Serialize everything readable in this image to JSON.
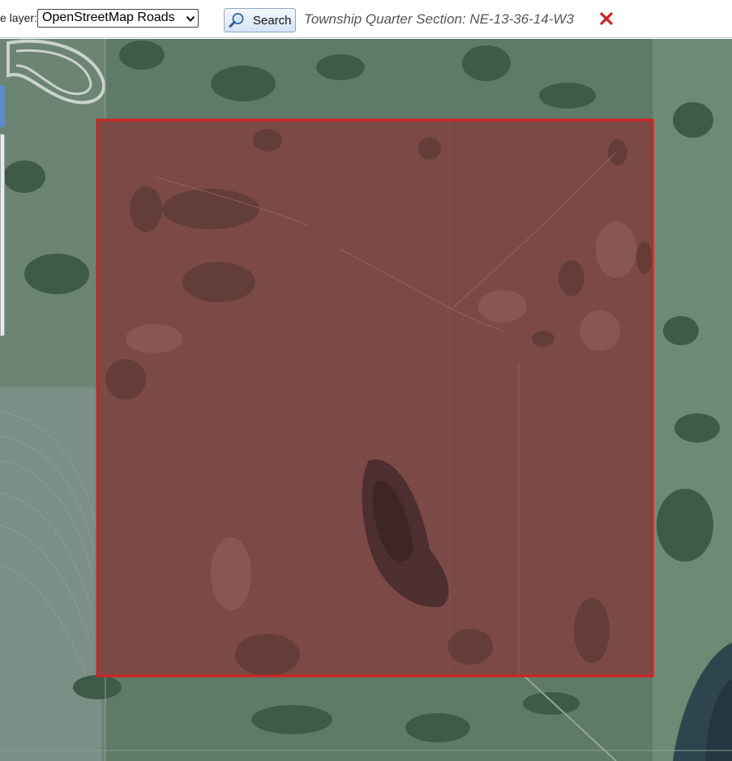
{
  "toolbar": {
    "layer_label": "e layer:",
    "layer_select_value": "OpenStreetMap Roads",
    "search_label": "Search",
    "section_text": "Township Quarter Section: NE-13-36-14-W3"
  },
  "icons": {
    "select": "chevron-down-icon",
    "search": "magnifier-icon",
    "close": "close-icon"
  },
  "colors": {
    "highlight_stroke": "#d42020",
    "highlight_fill": "#8a3f42",
    "close_red": "#d02020"
  }
}
